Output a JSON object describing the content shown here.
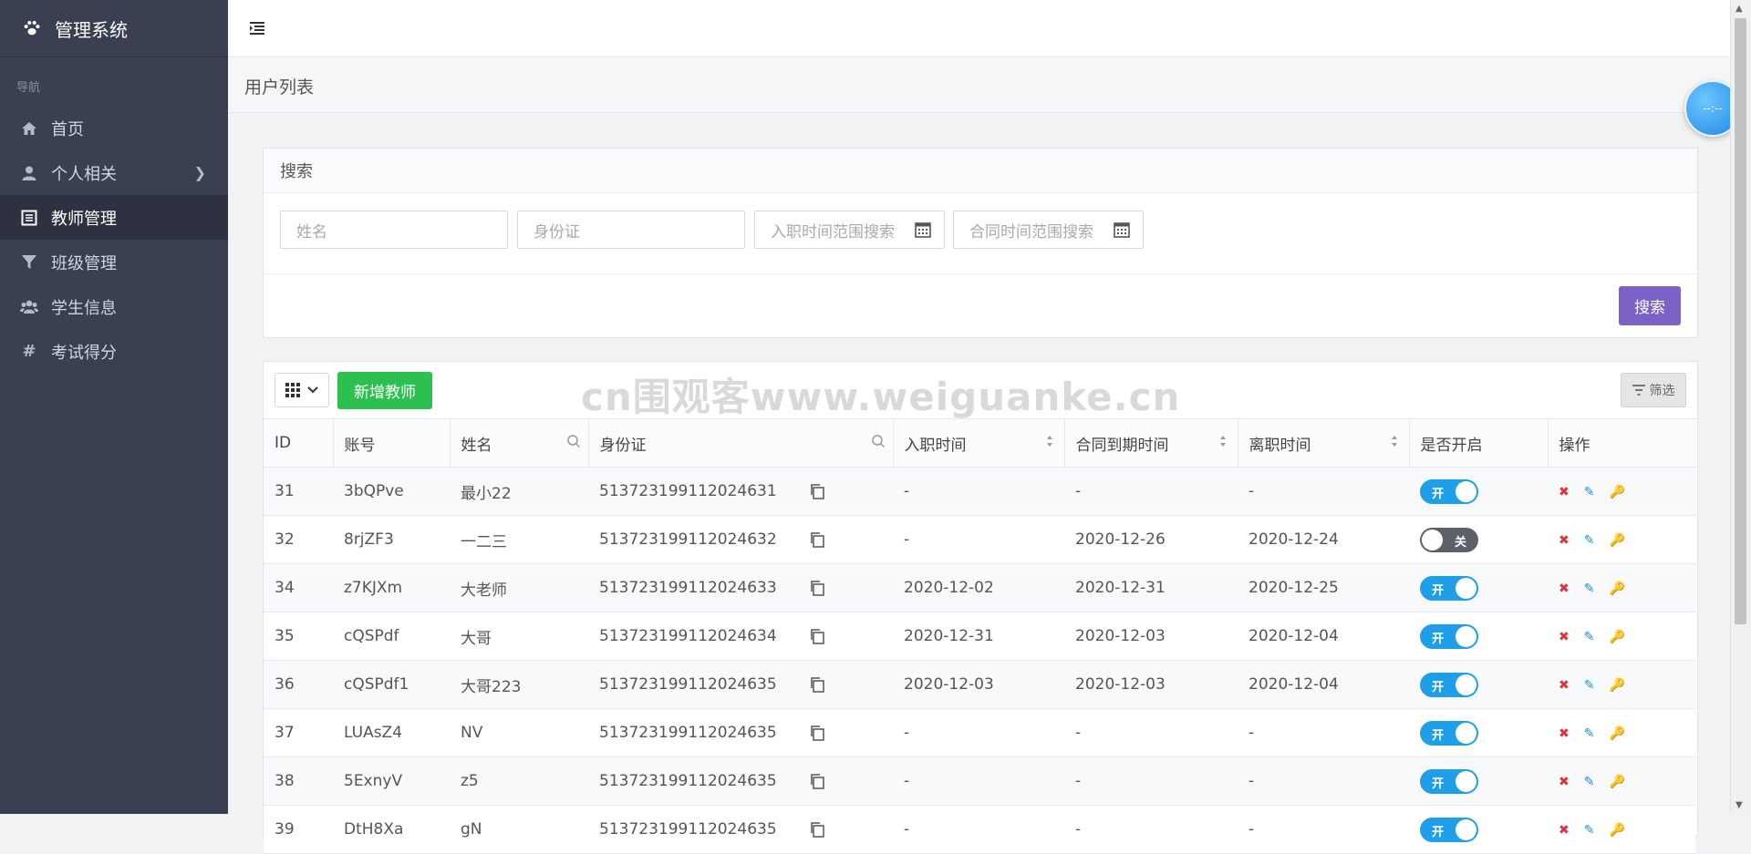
{
  "app": {
    "title": "管理系统"
  },
  "sidebar": {
    "heading": "导航",
    "items": [
      {
        "label": "首页",
        "icon": "home-icon"
      },
      {
        "label": "个人相关",
        "icon": "user-icon",
        "has_children": true
      },
      {
        "label": "教师管理",
        "icon": "list-icon",
        "active": true
      },
      {
        "label": "班级管理",
        "icon": "filter-icon"
      },
      {
        "label": "学生信息",
        "icon": "users-icon"
      },
      {
        "label": "考试得分",
        "icon": "hashtag-icon"
      }
    ]
  },
  "page": {
    "title": "用户列表"
  },
  "search": {
    "title": "搜索",
    "name_placeholder": "姓名",
    "id_placeholder": "身份证",
    "hire_range_placeholder": "入职时间范围搜索",
    "contract_range_placeholder": "合同时间范围搜索",
    "button": "搜索"
  },
  "toolbar": {
    "add_label": "新增教师",
    "filter_label": "筛选"
  },
  "watermark": "cn围观客www.weiguanke.cn",
  "clock": {
    "text": "--:--"
  },
  "table": {
    "headers": [
      "ID",
      "账号",
      "姓名",
      "身份证",
      "入职时间",
      "合同到期时间",
      "离职时间",
      "是否开启",
      "操作"
    ],
    "switch_on": "开",
    "switch_off": "关",
    "rows": [
      {
        "id": "31",
        "account": "3bQPve",
        "name": "最小22",
        "idcard": "513723199112024631",
        "hire": "-",
        "contract_end": "-",
        "leave": "-",
        "enabled": true
      },
      {
        "id": "32",
        "account": "8rjZF3",
        "name": "一二三",
        "idcard": "513723199112024632",
        "hire": "-",
        "contract_end": "2020-12-26",
        "leave": "2020-12-24",
        "enabled": false
      },
      {
        "id": "34",
        "account": "z7KJXm",
        "name": "大老师",
        "idcard": "513723199112024633",
        "hire": "2020-12-02",
        "contract_end": "2020-12-31",
        "leave": "2020-12-25",
        "enabled": true
      },
      {
        "id": "35",
        "account": "cQSPdf",
        "name": "大哥",
        "idcard": "513723199112024634",
        "hire": "2020-12-31",
        "contract_end": "2020-12-03",
        "leave": "2020-12-04",
        "enabled": true
      },
      {
        "id": "36",
        "account": "cQSPdf1",
        "name": "大哥223",
        "idcard": "513723199112024635",
        "hire": "2020-12-03",
        "contract_end": "2020-12-03",
        "leave": "2020-12-04",
        "enabled": true
      },
      {
        "id": "37",
        "account": "LUAsZ4",
        "name": "NV",
        "idcard": "513723199112024635",
        "hire": "-",
        "contract_end": "-",
        "leave": "-",
        "enabled": true
      },
      {
        "id": "38",
        "account": "5ExnyV",
        "name": "z5",
        "idcard": "513723199112024635",
        "hire": "-",
        "contract_end": "-",
        "leave": "-",
        "enabled": true
      },
      {
        "id": "39",
        "account": "DtH8Xa",
        "name": "gN",
        "idcard": "513723199112024635",
        "hire": "-",
        "contract_end": "-",
        "leave": "-",
        "enabled": true
      }
    ]
  }
}
